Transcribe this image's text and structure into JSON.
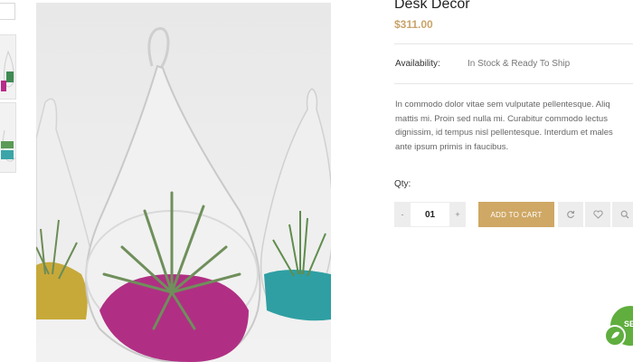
{
  "product": {
    "title": "Desk Decor",
    "price": "$311.00",
    "availability_label": "Availability:",
    "availability_value": "In Stock & Ready To Ship",
    "description_lines": [
      "In commodo dolor vitae sem vulputate pellentesque. Aliq",
      "mattis mi. Proin sed nulla mi. Curabitur commodo lectus",
      "dignissim, id tempus nisl pellentesque. Interdum et males",
      "ante ipsum primis in faucibus."
    ]
  },
  "purchase": {
    "qty_label": "Qty:",
    "qty_minus": "-",
    "qty_value": "01",
    "qty_plus": "+",
    "add_to_cart_label": "ADD TO CART"
  },
  "actions": {
    "icons": [
      "refresh-icon",
      "heart-icon",
      "search-icon"
    ]
  },
  "chat_badge": {
    "text": "SE"
  },
  "colors": {
    "accent": "#cfa865",
    "price": "#c9a46a",
    "button_bg": "#ededed",
    "badge_green": "#5fae3e"
  }
}
